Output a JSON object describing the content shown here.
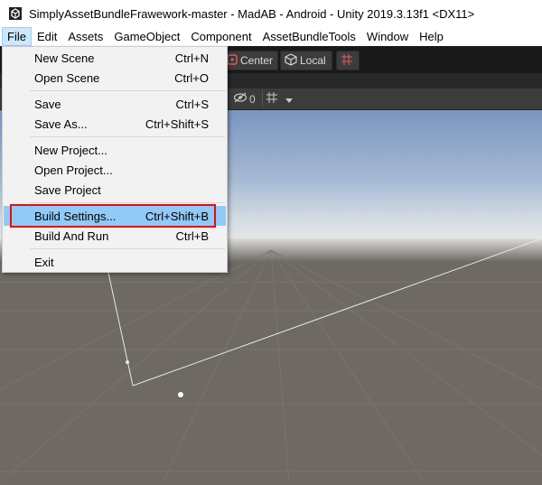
{
  "window": {
    "title": "SimplyAssetBundleFrawework-master - MadAB - Android - Unity 2019.3.13f1 <DX11>"
  },
  "menubar": {
    "items": [
      "File",
      "Edit",
      "Assets",
      "GameObject",
      "Component",
      "AssetBundleTools",
      "Window",
      "Help"
    ]
  },
  "toolbar": {
    "pivot_label": "Center",
    "rotation_label": "Local"
  },
  "scene_toolbar": {
    "hidden_count": "0"
  },
  "file_menu": {
    "items": [
      {
        "label": "New Scene",
        "shortcut": "Ctrl+N"
      },
      {
        "label": "Open Scene",
        "shortcut": "Ctrl+O"
      },
      {
        "label": "Save",
        "shortcut": "Ctrl+S"
      },
      {
        "label": "Save As...",
        "shortcut": "Ctrl+Shift+S"
      },
      {
        "label": "New Project...",
        "shortcut": ""
      },
      {
        "label": "Open Project...",
        "shortcut": ""
      },
      {
        "label": "Save Project",
        "shortcut": ""
      },
      {
        "label": "Build Settings...",
        "shortcut": "Ctrl+Shift+B",
        "highlighted": true
      },
      {
        "label": "Build And Run",
        "shortcut": "Ctrl+B"
      },
      {
        "label": "Exit",
        "shortcut": ""
      }
    ]
  },
  "colors": {
    "highlight": "#91c9f7",
    "annotation": "#e01010",
    "sky_top": "#7a95c0",
    "ground": "#6e6963"
  }
}
